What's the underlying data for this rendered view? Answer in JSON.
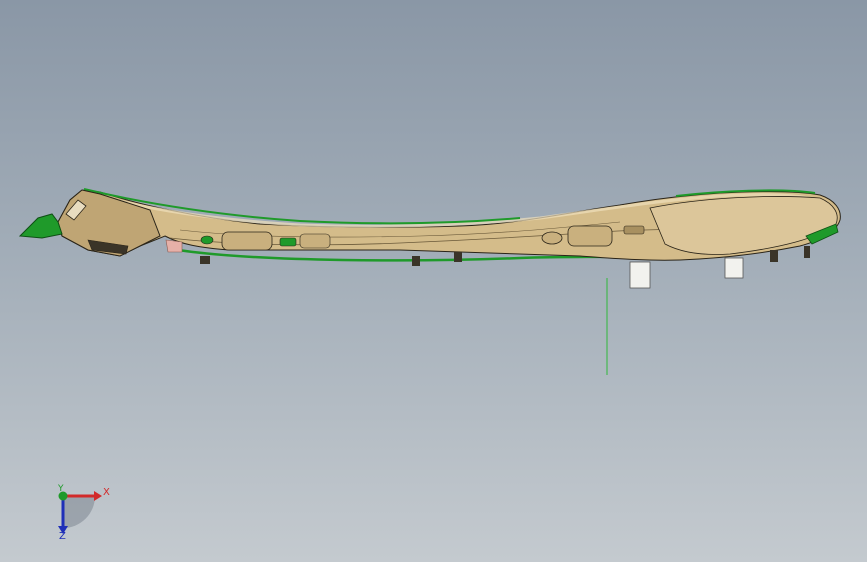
{
  "viewport": {
    "background_top": "#8a97a6",
    "background_bottom": "#c4cacf"
  },
  "model": {
    "part_color": "#d4bc8a",
    "edge_color": "#2a2418",
    "flange_color": "#1f9a2a",
    "accent_color": "#e6b0a8",
    "tab_color": "#f2f2ee"
  },
  "triad": {
    "x_label": "X",
    "y_label": "Y",
    "z_label": "Z",
    "x_color": "#d22a2a",
    "y_color": "#1f9a2a",
    "z_color": "#1f2fb8"
  }
}
